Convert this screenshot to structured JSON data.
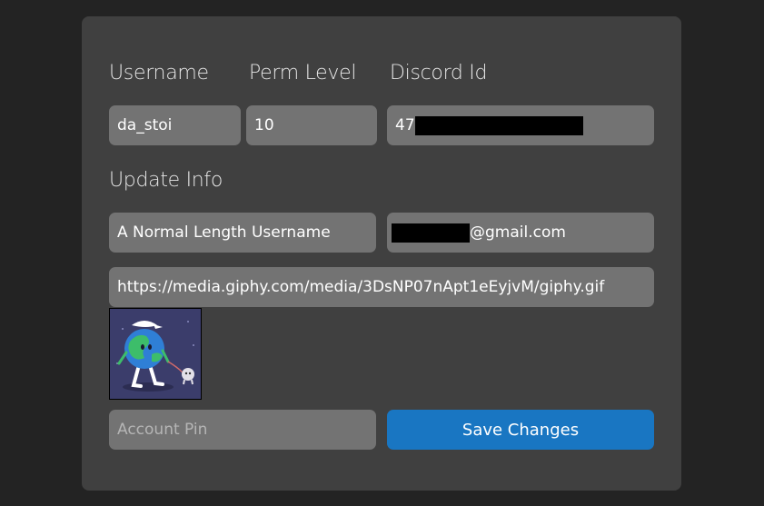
{
  "labels": {
    "username": "Username",
    "perm_level": "Perm Level",
    "discord_id": "Discord Id",
    "update_info": "Update Info"
  },
  "user": {
    "username": "da_stoi",
    "perm_level": "10",
    "discord_id_visible": "47"
  },
  "update": {
    "display_name": "A Normal Length Username",
    "email_suffix": "@gmail.com",
    "avatar_url": "https://media.giphy.com/media/3DsNP07nApt1eEyjvM/giphy.gif",
    "pin_placeholder": "Account Pin"
  },
  "actions": {
    "save_label": "Save Changes"
  },
  "colors": {
    "background": "#232323",
    "card": "#404040",
    "field": "#737373",
    "accent": "#1976c2"
  },
  "preview_image": {
    "icon": "walking-earth-gif-preview"
  }
}
